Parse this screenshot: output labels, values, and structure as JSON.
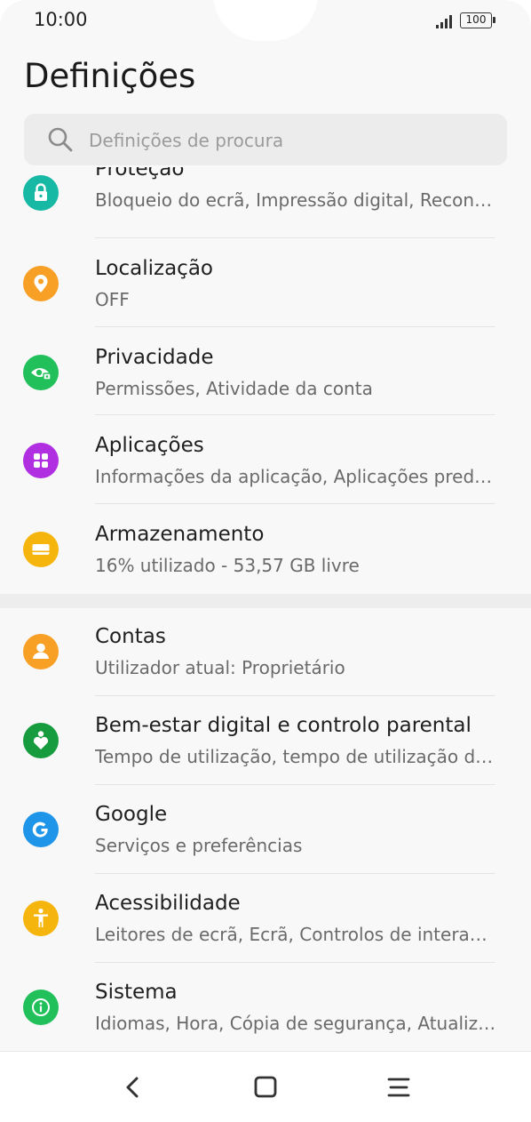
{
  "status_bar": {
    "time": "10:00",
    "battery": "100"
  },
  "header": {
    "title": "Definições"
  },
  "search": {
    "placeholder": "Definições de procura"
  },
  "colors": {
    "protecao": "#17b9a4",
    "localizacao": "#f7a025",
    "privacidade": "#21c05b",
    "aplicacoes": "#b02fe0",
    "armazenamento": "#f5b50c",
    "contas": "#f7a025",
    "bemestar": "#169c3f",
    "google": "#1e95e8",
    "acessibilidade": "#f5b50c",
    "sistema": "#21c05b"
  },
  "items": [
    {
      "icon": "lock-icon",
      "title": "Proteção",
      "subtitle": "Bloqueio do ecrã, Impressão digital, Reconhecimento facial"
    },
    {
      "icon": "location-pin-icon",
      "title": "Localização",
      "subtitle": "OFF"
    },
    {
      "icon": "eye-lock-icon",
      "title": "Privacidade",
      "subtitle": "Permissões, Atividade da conta"
    },
    {
      "icon": "apps-grid-icon",
      "title": "Aplicações",
      "subtitle": "Informações da aplicação, Aplicações predefinidas"
    },
    {
      "icon": "storage-icon",
      "title": "Armazenamento",
      "subtitle": "16% utilizado - 53,57 GB livre"
    },
    {
      "icon": "person-icon",
      "title": "Contas",
      "subtitle": "Utilizador atual: Proprietário"
    },
    {
      "icon": "wellbeing-heart-icon",
      "title": "Bem-estar digital e controlo parental",
      "subtitle": "Tempo de utilização, tempo de utilização da aplicação"
    },
    {
      "icon": "google-g-icon",
      "title": "Google",
      "subtitle": "Serviços e preferências"
    },
    {
      "icon": "accessibility-icon",
      "title": "Acessibilidade",
      "subtitle": "Leitores de ecrã, Ecrã, Controlos de interação"
    },
    {
      "icon": "info-icon",
      "title": "Sistema",
      "subtitle": "Idiomas, Hora, Cópia de segurança, Atualizações"
    }
  ],
  "nav": {
    "back": "back-icon",
    "home": "home-icon",
    "menu": "menu-icon"
  }
}
